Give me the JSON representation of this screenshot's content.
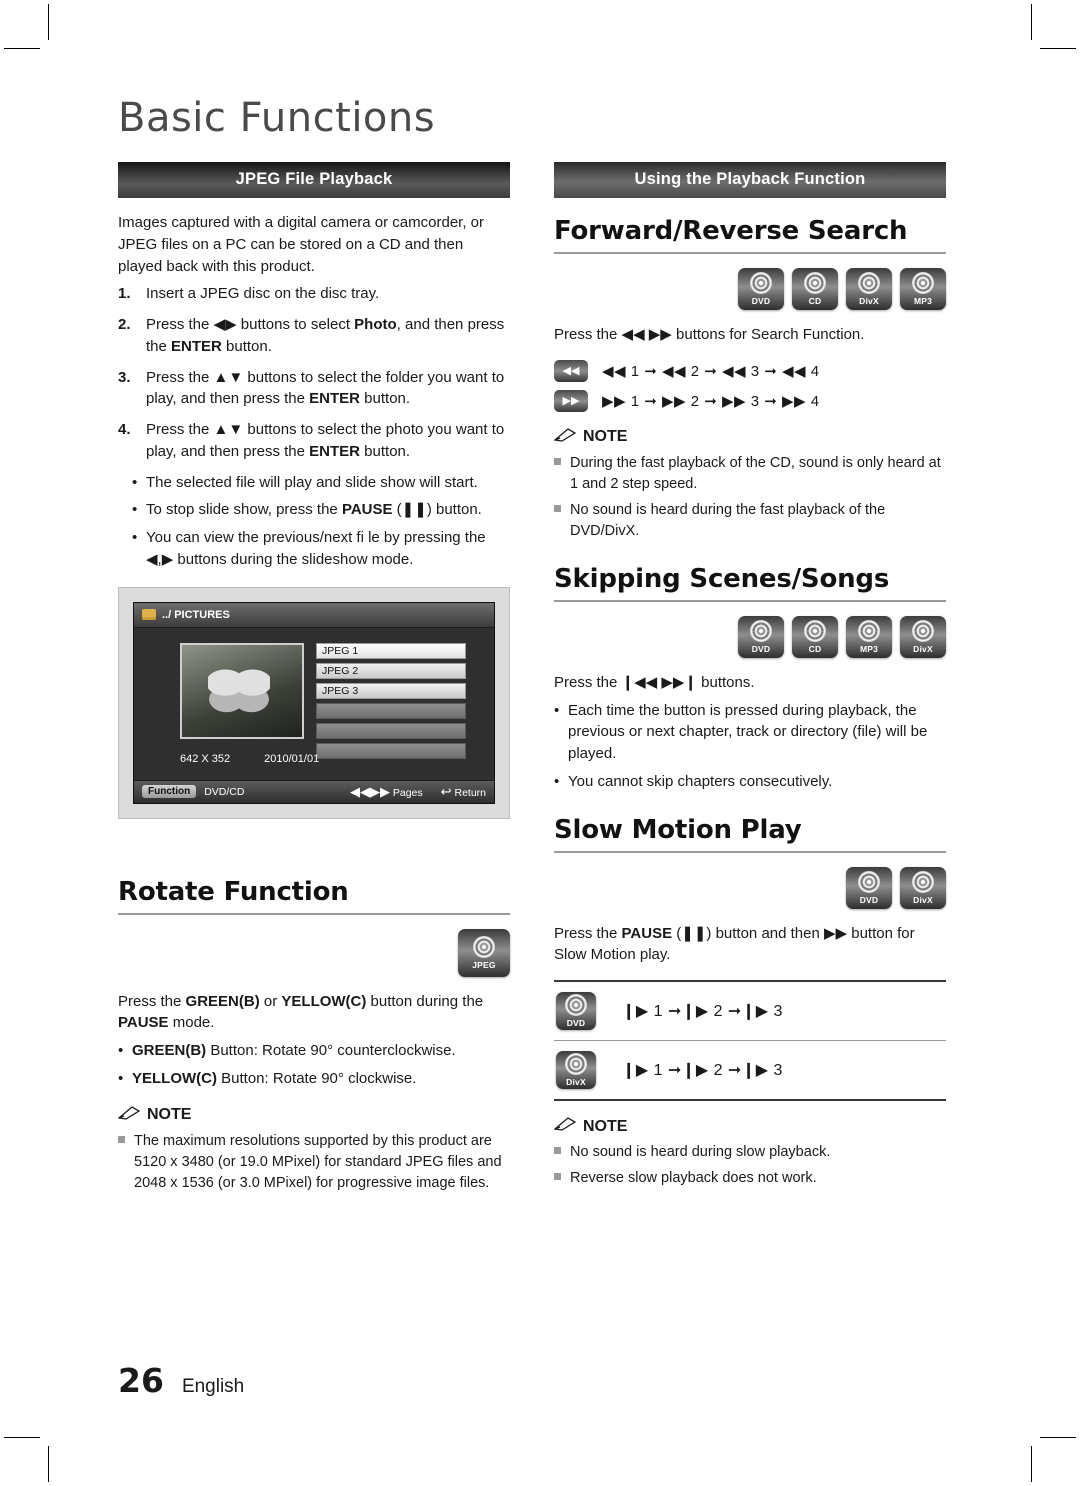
{
  "chapter_title": "Basic Functions",
  "left": {
    "section_bar": "JPEG File Playback",
    "intro": "Images captured with a digital camera or camcorder, or JPEG files on a PC can be stored on a CD and then played back with this product.",
    "steps": [
      {
        "num": "1.",
        "text": "Insert a JPEG disc on the disc tray."
      },
      {
        "num": "2.",
        "text": "Press the ◀▶ buttons to select Photo, and then press the ENTER button."
      },
      {
        "num": "3.",
        "text": "Press the ▲▼ buttons to select the folder you want to play, and then press the ENTER button."
      },
      {
        "num": "4.",
        "text": "Press the ▲▼ buttons to select the photo you want to play, and then press the ENTER button."
      }
    ],
    "bullets": [
      "The selected file will play and slide show will start.",
      "To stop slide show, press the PAUSE (❚❚) button.",
      "You can view the previous/next fi le by pressing the ◀,▶ buttons during the slideshow mode."
    ],
    "screen": {
      "title": "../ PICTURES",
      "files": [
        "JPEG 1",
        "JPEG 2",
        "JPEG 3"
      ],
      "resolution": "642 X 352",
      "date": "2010/01/01",
      "function_label": "Function",
      "function_value": "DVD/CD",
      "pages_label": "Pages",
      "return_label": "Return"
    },
    "rotate": {
      "heading": "Rotate Function",
      "badge": {
        "label": "JPEG"
      },
      "intro": "Press the GREEN(B) or YELLOW(C) button during the PAUSE mode.",
      "bullets": [
        "GREEN(B) Button: Rotate 90° counterclockwise.",
        "YELLOW(C) Button: Rotate 90° clockwise."
      ],
      "note_title": "NOTE",
      "notes": [
        "The maximum resolutions supported by this product are 5120 x 3480 (or 19.0 MPixel) for standard JPEG files and 2048 x 1536 (or 3.0 MPixel) for progressive image files."
      ]
    }
  },
  "right": {
    "section_bar": "Using the Playback Function",
    "search": {
      "heading": "Forward/Reverse Search",
      "badges": [
        "DVD",
        "CD",
        "DivX",
        "MP3"
      ],
      "intro": "Press the ◀◀ ▶▶ buttons for Search Function.",
      "rows": [
        {
          "key": "◀◀",
          "sequence": "◀◀ 1 ➞ ◀◀ 2 ➞ ◀◀ 3 ➞ ◀◀ 4"
        },
        {
          "key": "▶▶",
          "sequence": "▶▶ 1 ➞ ▶▶ 2 ➞ ▶▶ 3 ➞ ▶▶ 4"
        }
      ],
      "note_title": "NOTE",
      "notes": [
        "During the fast playback of the CD, sound is only heard at 1 and 2 step speed.",
        "No sound is heard during the fast playback of the DVD/DivX."
      ]
    },
    "skipping": {
      "heading": "Skipping Scenes/Songs",
      "badges": [
        "DVD",
        "CD",
        "MP3",
        "DivX"
      ],
      "intro": "Press the ❙◀◀ ▶▶❙ buttons.",
      "bullets": [
        "Each time the button is pressed during playback, the previous or next chapter, track or directory (file) will be played.",
        "You cannot skip chapters consecutively."
      ]
    },
    "slow": {
      "heading": "Slow Motion Play",
      "badges": [
        "DVD",
        "DivX"
      ],
      "intro": "Press the PAUSE (❚❚) button and then ▶▶ button for Slow Motion play.",
      "rows": [
        {
          "badge": "DVD",
          "sequence": "❙▶ 1 ➞❙▶ 2 ➞❙▶ 3"
        },
        {
          "badge": "DivX",
          "sequence": "❙▶ 1 ➞❙▶ 2 ➞❙▶ 3"
        }
      ],
      "note_title": "NOTE",
      "notes": [
        "No sound is heard during slow playback.",
        "Reverse slow playback does not work."
      ]
    }
  },
  "footer": {
    "page_number": "26",
    "language": "English"
  }
}
